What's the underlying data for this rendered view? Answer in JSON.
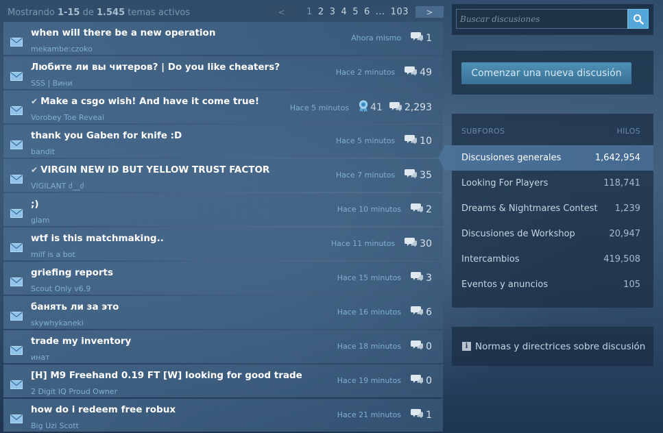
{
  "summary": {
    "prefix": "Mostrando",
    "range": "1-15",
    "of": "de",
    "total": "1.545",
    "suffix": "temas activos"
  },
  "pager": {
    "prev": "<",
    "next": ">",
    "pages": [
      "1",
      "2",
      "3",
      "4",
      "5",
      "6",
      "...",
      "103"
    ],
    "current": "1"
  },
  "topics": [
    {
      "title": "when will there be a new operation",
      "author": "mekambe:czoko",
      "time": "Ahora mismo",
      "replies": "1",
      "pinned": false,
      "award": ""
    },
    {
      "title": "Любите ли вы читеров? | Do you like cheaters?",
      "author": "SSS | Вини",
      "time": "Hace 2 minutos",
      "replies": "49",
      "pinned": false,
      "award": ""
    },
    {
      "title": "Make a csgo wish! And have it come true!",
      "author": "Vorobey Toe Reveal",
      "time": "Hace 5 minutos",
      "replies": "2,293",
      "pinned": true,
      "award": "41"
    },
    {
      "title": "thank you Gaben for knife :D",
      "author": "bandit",
      "time": "Hace 5 minutos",
      "replies": "10",
      "pinned": false,
      "award": ""
    },
    {
      "title": "VIRGIN NEW ID BUT YELLOW TRUST FACTOR",
      "author": "VIGILANT ძ__ძ",
      "time": "Hace 7 minutos",
      "replies": "35",
      "pinned": true,
      "award": ""
    },
    {
      "title": ";)",
      "author": "glam",
      "time": "Hace 10 minutos",
      "replies": "2",
      "pinned": false,
      "award": ""
    },
    {
      "title": "wtf is this matchmaking..",
      "author": "milf is a bot",
      "time": "Hace 11 minutos",
      "replies": "30",
      "pinned": false,
      "award": ""
    },
    {
      "title": "griefing reports",
      "author": "Scout Only v6.9",
      "time": "Hace 15 minutos",
      "replies": "3",
      "pinned": false,
      "award": ""
    },
    {
      "title": "банять ли за это",
      "author": "skywhykaneki",
      "time": "Hace 16 minutos",
      "replies": "6",
      "pinned": false,
      "award": ""
    },
    {
      "title": "trade my inventory",
      "author": "инат",
      "time": "Hace 18 minutos",
      "replies": "0",
      "pinned": false,
      "award": ""
    },
    {
      "title": "[H] M9 Freehand 0.19 FT [W] looking for good trade",
      "author": "2 Digit IQ Proud Owner",
      "time": "Hace 19 minutos",
      "replies": "0",
      "pinned": false,
      "award": ""
    },
    {
      "title": "how do i redeem free robux",
      "author": "Big Uzi Scott",
      "time": "Hace 21 minutos",
      "replies": "1",
      "pinned": false,
      "award": ""
    }
  ],
  "search": {
    "placeholder": "Buscar discusiones",
    "icon": "search-icon"
  },
  "new_discussion": {
    "label": "Comenzar una nueva discusión"
  },
  "subforums": {
    "header_left": "SUBFOROS",
    "header_right": "HILOS",
    "items": [
      {
        "name": "Discusiones generales",
        "count": "1,642,954",
        "active": true
      },
      {
        "name": "Looking For Players",
        "count": "118,741",
        "active": false
      },
      {
        "name": "Dreams & Nightmares Contest",
        "count": "1,239",
        "active": false
      },
      {
        "name": "Discusiones de Workshop",
        "count": "20,947",
        "active": false
      },
      {
        "name": "Intercambios",
        "count": "419,508",
        "active": false
      },
      {
        "name": "Eventos y anuncios",
        "count": "105",
        "active": false
      }
    ]
  },
  "rules": {
    "label": "Normas y directrices sobre discusión",
    "icon": "info-icon"
  },
  "colors": {
    "accent": "#56a5d8",
    "topic_bg": "#4b6e91",
    "link": "#7fb0d3",
    "active_subforum": "#4b7199"
  }
}
